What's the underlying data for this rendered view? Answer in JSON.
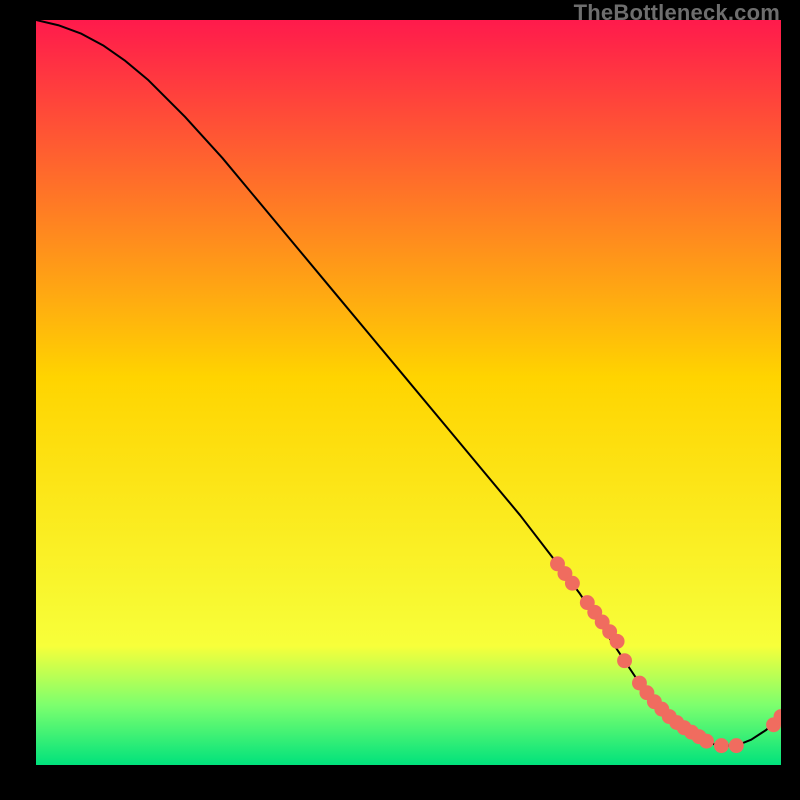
{
  "watermark": "TheBottleneck.com",
  "colors": {
    "bg": "#000000",
    "grad_top": "#ff1a4c",
    "grad_mid": "#ffd400",
    "grad_bot_yellow": "#f7ff3a",
    "grad_bot_green1": "#7cff6e",
    "grad_bot_green2": "#00e27c",
    "curve": "#000000",
    "marker": "#f06c5f"
  },
  "chart_data": {
    "type": "line",
    "title": "",
    "xlabel": "",
    "ylabel": "",
    "xlim": [
      0,
      100
    ],
    "ylim": [
      0,
      100
    ],
    "series": [
      {
        "name": "curve",
        "x": [
          0,
          3,
          6,
          9,
          12,
          15,
          20,
          25,
          30,
          35,
          40,
          45,
          50,
          55,
          60,
          65,
          70,
          73,
          75,
          77,
          79,
          81,
          83,
          85,
          87,
          89,
          90,
          91,
          92,
          94,
          96,
          98,
          100
        ],
        "y": [
          100,
          99.3,
          98.2,
          96.6,
          94.5,
          92,
          87,
          81.5,
          75.5,
          69.5,
          63.5,
          57.5,
          51.5,
          45.5,
          39.5,
          33.5,
          27,
          23,
          20,
          17,
          14,
          11,
          8.5,
          6.5,
          5,
          3.8,
          3.2,
          2.8,
          2.6,
          2.6,
          3.4,
          4.7,
          6.5
        ]
      }
    ],
    "markers": {
      "name": "dots",
      "x": [
        70,
        71,
        72,
        74,
        75,
        76,
        77,
        78,
        79,
        81,
        82,
        83,
        84,
        85,
        86,
        87,
        88,
        89,
        90,
        92,
        94,
        99,
        100
      ],
      "y": [
        27,
        25.7,
        24.4,
        21.8,
        20.5,
        19.2,
        17.9,
        16.6,
        14.0,
        11.0,
        9.7,
        8.5,
        7.5,
        6.5,
        5.7,
        5.0,
        4.4,
        3.8,
        3.2,
        2.6,
        2.6,
        5.4,
        6.5
      ]
    },
    "gradient_stops": [
      {
        "offset": 0.0,
        "color_key": "grad_top"
      },
      {
        "offset": 0.48,
        "color_key": "grad_mid"
      },
      {
        "offset": 0.84,
        "color_key": "grad_bot_yellow"
      },
      {
        "offset": 0.92,
        "color_key": "grad_bot_green1"
      },
      {
        "offset": 1.0,
        "color_key": "grad_bot_green2"
      }
    ]
  }
}
